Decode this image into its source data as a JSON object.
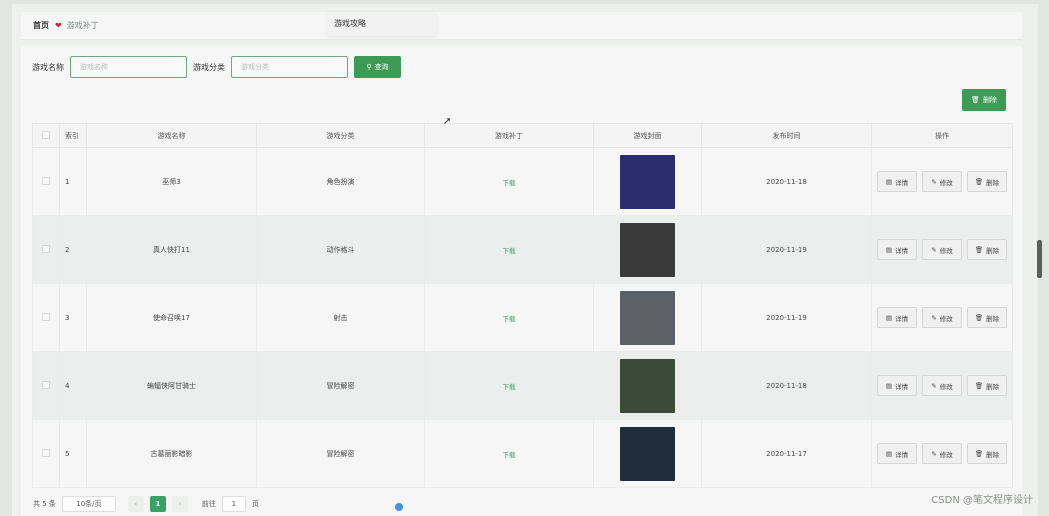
{
  "breadcrumb": {
    "home": "首页",
    "current": "游戏补丁"
  },
  "dropdown": {
    "item": "游戏攻略"
  },
  "search": {
    "name_label": "游戏名称",
    "name_placeholder": "游戏名称",
    "category_label": "游戏分类",
    "category_placeholder": "游戏分类",
    "query_label": "查询"
  },
  "toolbar": {
    "delete_label": "删除"
  },
  "table": {
    "headers": {
      "index": "索引",
      "name": "游戏名称",
      "category": "游戏分类",
      "patch": "游戏补丁",
      "cover": "游戏封面",
      "date": "发布时间",
      "ops": "操作"
    },
    "rows": [
      {
        "index": "1",
        "name": "巫师3",
        "category": "角色扮演",
        "patch": "下载",
        "date": "2020-11-18",
        "cover_color": "#2a2d6e"
      },
      {
        "index": "2",
        "name": "真人快打11",
        "category": "动作格斗",
        "patch": "下载",
        "date": "2020-11-19",
        "cover_color": "#3a3a3a"
      },
      {
        "index": "3",
        "name": "使命召唤17",
        "category": "射击",
        "patch": "下载",
        "date": "2020-11-19",
        "cover_color": "#5a6268"
      },
      {
        "index": "4",
        "name": "蝙蝠侠阿甘骑士",
        "category": "冒险解密",
        "patch": "下载",
        "date": "2020-11-18",
        "cover_color": "#3c4a3a"
      },
      {
        "index": "5",
        "name": "古墓丽影暗影",
        "category": "冒险解密",
        "patch": "下载",
        "date": "2020-11-17",
        "cover_color": "#1f2e3a"
      }
    ],
    "op_labels": {
      "detail": "详情",
      "edit": "修改",
      "delete": "删除"
    }
  },
  "pager": {
    "total": "共 5 条",
    "page_size": "10条/页",
    "current_page": "1",
    "goto_label": "前往",
    "goto_value": "1",
    "page_suffix": "页"
  },
  "watermark": "CSDN @笔文程序设计",
  "colors": {
    "primary": "#3e9a54",
    "download_link": "#3aa266",
    "heart": "#c0293a"
  }
}
